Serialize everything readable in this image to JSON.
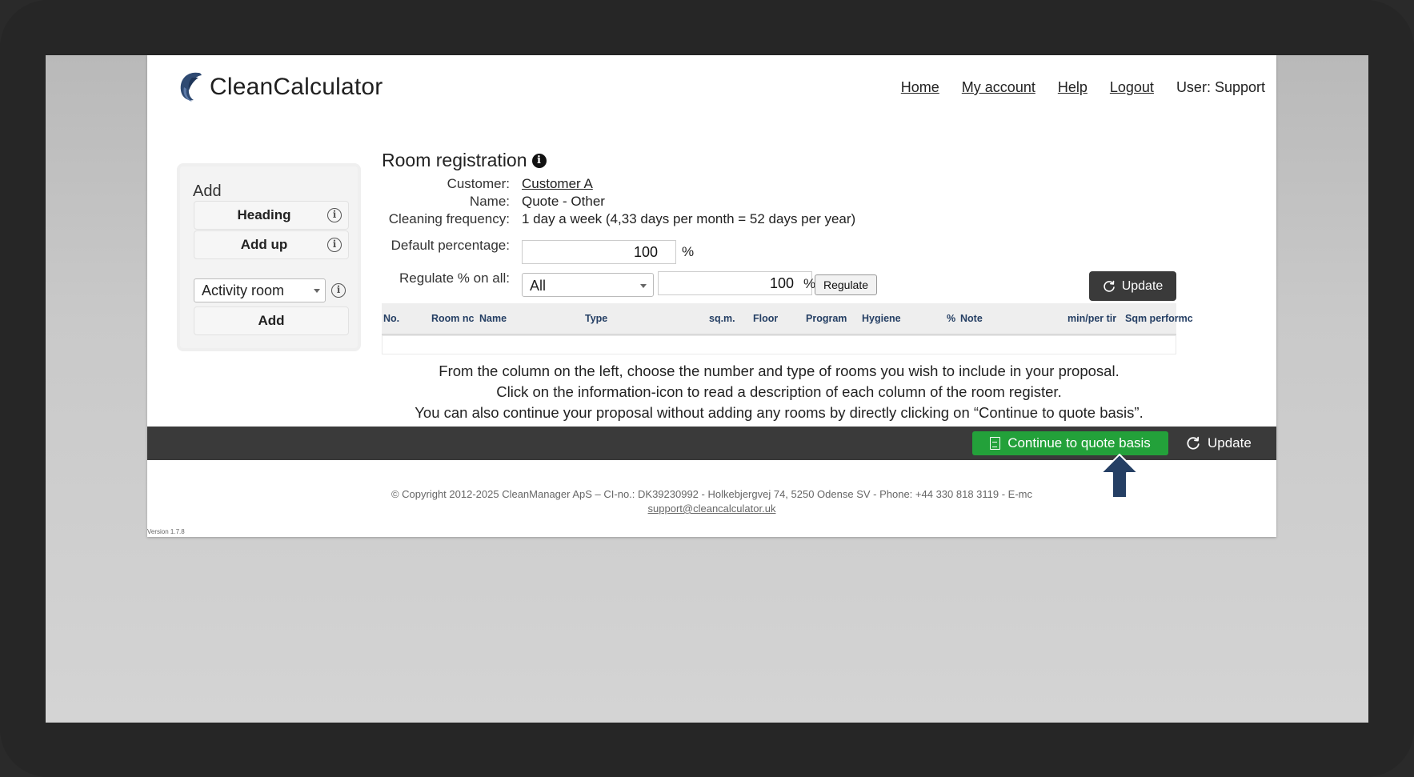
{
  "brand": {
    "name": "CleanCalculator"
  },
  "nav": {
    "home": "Home",
    "my_account": "My account",
    "help": "Help",
    "logout": "Logout",
    "user": "User: Support"
  },
  "add_panel": {
    "title": "Add",
    "heading_button": "Heading",
    "add_up_button": "Add up",
    "room_type_selected": "Activity room",
    "add_button": "Add"
  },
  "room_registration": {
    "title": "Room registration",
    "customer_label": "Customer:",
    "customer_value": "Customer A",
    "name_label": "Name:",
    "name_value": "Quote - Other",
    "frequency_label": "Cleaning frequency:",
    "frequency_value": "1 day a week (4,33 days per month = 52 days per year)",
    "default_pct_label": "Default percentage:",
    "default_pct_value": "100",
    "pct_symbol": "%",
    "regulate_label": "Regulate % on all:",
    "regulate_selected": "All",
    "regulate_value": "100",
    "regulate_button": "Regulate",
    "update_button": "Update"
  },
  "table": {
    "columns": [
      "No.",
      "Room nc",
      "Name",
      "Type",
      "sq.m.",
      "Floor",
      "Program",
      "Hygiene",
      "%",
      "Note",
      "min/per tir",
      "Sqm performc"
    ]
  },
  "instructions": {
    "line1": "From the column on the left, choose the number and type of rooms you wish to include in your proposal.",
    "line2": "Click on the information-icon to read a description of each column of the room register.",
    "line3": "You can also continue your proposal without adding any rooms by directly clicking on “Continue to quote basis”."
  },
  "bottom_bar": {
    "continue_button": "Continue to quote basis",
    "update_button": "Update"
  },
  "footer": {
    "copyright": "© Copyright 2012-2025 CleanManager ApS – CI-no.: DK39230992 - Holkebjergvej 74, 5250 Odense SV - Phone: +44 330 818 3119 - E-mc",
    "email": "support@cleancalculator.uk",
    "version": "Version 1.7.8"
  },
  "colors": {
    "accent_green": "#23a13a",
    "dark_bar": "#3a3a3a",
    "header_text": "#253f64",
    "arrow": "#253f64"
  }
}
